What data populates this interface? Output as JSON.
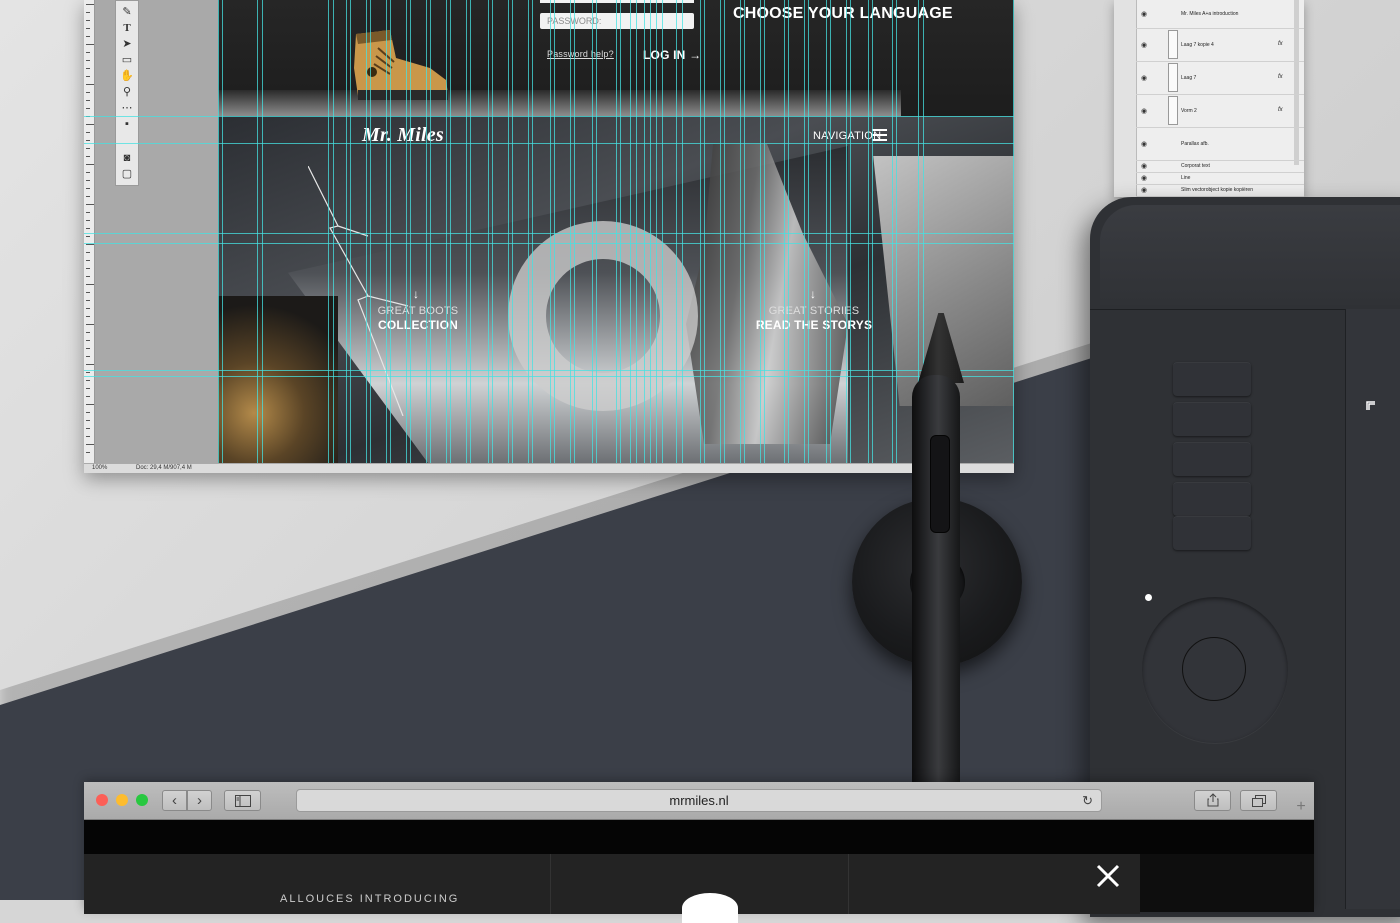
{
  "photoshop": {
    "statusbar": {
      "zoom": "100%",
      "doc": "Doc: 29,4 M/907,4 M"
    },
    "tools": [
      "pen-icon",
      "type-icon",
      "path-select-icon",
      "rectangle-icon",
      "hand-icon",
      "zoom-icon",
      "more-icon",
      "colors-icon",
      "quickmask-icon",
      "screen-mode-icon"
    ]
  },
  "site": {
    "password_placeholder": "PASSWORD:",
    "password_help": "Password help?",
    "login": "LOG IN",
    "login_arrow": "→",
    "choose_language": "CHOOSE YOUR LANGUAGE",
    "logo": "Mr. Miles",
    "navigation": "NAVIGATION",
    "boots_sub": "GREAT BOOTS",
    "boots_title": "COLLECTION",
    "stories_sub": "GREAT STORIES",
    "stories_title": "READ THE STORYS",
    "arrow": "↓"
  },
  "layers": [
    {
      "name": "Mr. Miles A+a introduction",
      "kind": "text",
      "fx": false
    },
    {
      "name": "Laag 7 kopie 4",
      "kind": "layer",
      "fx": true
    },
    {
      "name": "Laag 7",
      "kind": "layer",
      "fx": true
    },
    {
      "name": "Vorm 2",
      "kind": "shape",
      "fx": true
    },
    {
      "name": "Parallax afb.",
      "kind": "group",
      "fx": false
    },
    {
      "name": "Corporat text",
      "kind": "group",
      "fx": false
    },
    {
      "name": "Line",
      "kind": "group",
      "fx": false
    },
    {
      "name": "Slim vectorobject kopie kopiëren",
      "kind": "smart",
      "fx": false
    }
  ],
  "layers_fx_label": "fx",
  "browser": {
    "url": "mrmiles.nl",
    "back": "‹",
    "forward": "›",
    "intro_text": "ALLOUCES INTRODUCING",
    "close": "×",
    "traffic_colors": [
      "#fc5f57",
      "#fdbc2e",
      "#28c840"
    ]
  }
}
